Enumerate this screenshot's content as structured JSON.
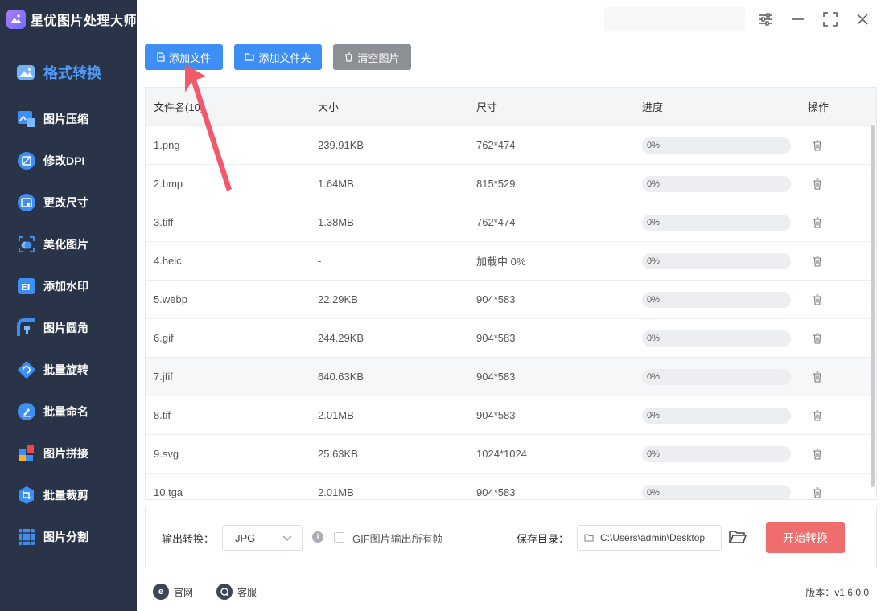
{
  "app": {
    "title": "星优图片处理大师",
    "search_value": ""
  },
  "sidebar": {
    "items": [
      {
        "label": "格式转换",
        "icon": "image-convert-icon",
        "active": true
      },
      {
        "label": "图片压缩",
        "icon": "image-compress-icon"
      },
      {
        "label": "修改DPI",
        "icon": "dpi-icon"
      },
      {
        "label": "更改尺寸",
        "icon": "resize-icon"
      },
      {
        "label": "美化图片",
        "icon": "beautify-icon"
      },
      {
        "label": "添加水印",
        "icon": "watermark-icon"
      },
      {
        "label": "图片圆角",
        "icon": "round-corner-icon"
      },
      {
        "label": "批量旋转",
        "icon": "rotate-icon"
      },
      {
        "label": "批量命名",
        "icon": "rename-icon"
      },
      {
        "label": "图片拼接",
        "icon": "stitch-icon"
      },
      {
        "label": "批量裁剪",
        "icon": "crop-icon"
      },
      {
        "label": "图片分割",
        "icon": "split-icon"
      }
    ]
  },
  "toolbar": {
    "add_file": "添加文件",
    "add_folder": "添加文件夹",
    "clear": "清空图片"
  },
  "table": {
    "headers": {
      "name": "文件名(10)",
      "size": "大小",
      "dimension": "尺寸",
      "progress": "进度",
      "action": "操作"
    },
    "rows": [
      {
        "name": "1.png",
        "size": "239.91KB",
        "dimension": "762*474",
        "progress": "0%"
      },
      {
        "name": "2.bmp",
        "size": "1.64MB",
        "dimension": "815*529",
        "progress": "0%"
      },
      {
        "name": "3.tiff",
        "size": "1.38MB",
        "dimension": "762*474",
        "progress": "0%"
      },
      {
        "name": "4.heic",
        "size": "-",
        "dimension": "加载中 0%",
        "progress": "0%"
      },
      {
        "name": "5.webp",
        "size": "22.29KB",
        "dimension": "904*583",
        "progress": "0%"
      },
      {
        "name": "6.gif",
        "size": "244.29KB",
        "dimension": "904*583",
        "progress": "0%"
      },
      {
        "name": "7.jfif",
        "size": "640.63KB",
        "dimension": "904*583",
        "progress": "0%"
      },
      {
        "name": "8.tif",
        "size": "2.01MB",
        "dimension": "904*583",
        "progress": "0%"
      },
      {
        "name": "9.svg",
        "size": "25.63KB",
        "dimension": "1024*1024",
        "progress": "0%"
      },
      {
        "name": "10.tga",
        "size": "2.01MB",
        "dimension": "904*583",
        "progress": "0%"
      }
    ]
  },
  "bottom": {
    "output_label": "输出转换：",
    "format_value": "JPG",
    "gif_option": "GIF图片输出所有帧",
    "save_label": "保存目录：",
    "save_path": "C:\\Users\\admin\\Desktop",
    "start_button": "开始转换"
  },
  "footer": {
    "website": "官网",
    "support": "客服",
    "version": "版本：v1.6.0.0"
  },
  "colors": {
    "sidebar_bg": "#2a3448",
    "accent_blue": "#3d8ff5",
    "start_red": "#f06d6d",
    "arrow_red": "#f25a6b"
  }
}
